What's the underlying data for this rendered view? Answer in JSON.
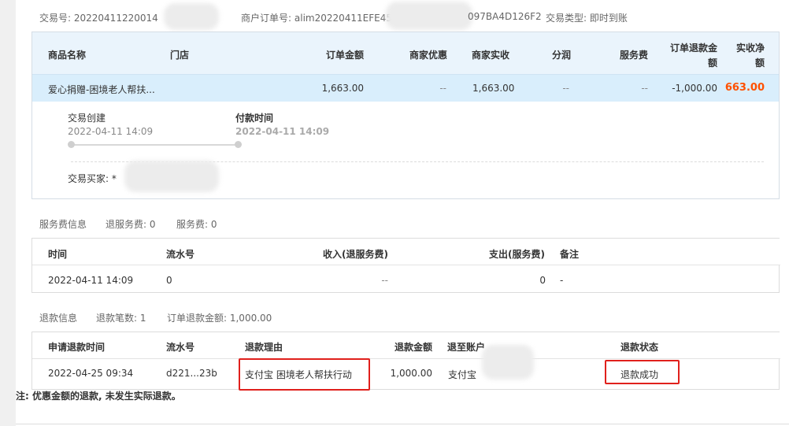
{
  "top_info": {
    "trade_no_label": "交易号:",
    "trade_no_value": "20220411220014",
    "merchant_order_label": "商户订单号:",
    "merchant_order_value": "alim20220411EFE458",
    "merchant_order_suffix": "097BA4D126F2",
    "trade_type_label": "交易类型:",
    "trade_type_value": "即时到账"
  },
  "order_table": {
    "headers": {
      "product": "商品名称",
      "store": "门店",
      "amount": "订单金额",
      "discount": "商家优惠",
      "received": "商家实收",
      "split": "分润",
      "service_fee": "服务费",
      "refund_amount_l1": "订单退款金",
      "refund_amount_l2": "额",
      "net_l1": "实收净",
      "net_l2": "额"
    },
    "row": {
      "product": "爱心捐赠-困境老人帮扶...",
      "amount": "1,663.00",
      "discount": "--",
      "received": "1,663.00",
      "split": "--",
      "service_fee": "--",
      "refund": "-1,000.00",
      "net": "663.00"
    },
    "timeline": {
      "created_label": "交易创建",
      "created_time": "2022-04-11 14:09",
      "paid_label": "付款时间",
      "paid_time": "2022-04-11 14:09"
    },
    "buyer_label": "交易买家: *"
  },
  "service_fee_info": {
    "title": "服务费信息",
    "refund_fee_label": "退服务费: 0",
    "fee_label": "服务费: 0",
    "headers": {
      "time": "时间",
      "serial": "流水号",
      "income": "收入(退服务费)",
      "expense": "支出(服务费)",
      "remark": "备注"
    },
    "row": {
      "time": "2022-04-11 14:09",
      "serial": "0",
      "income": "--",
      "expense": "0",
      "remark": "-"
    }
  },
  "refund_info": {
    "title": "退款信息",
    "count_label": "退款笔数: 1",
    "amount_label": "订单退款金额: 1,000.00",
    "headers": {
      "apply_time": "申请退款时间",
      "serial": "流水号",
      "reason": "退款理由",
      "amount": "退款金额",
      "account": "退至账户",
      "status": "退款状态"
    },
    "row": {
      "apply_time": "2022-04-25 09:34",
      "serial": "d221...23b",
      "reason": "支付宝 困境老人帮扶行动",
      "amount": "1,000.00",
      "account": "支付宝",
      "status": "退款成功"
    }
  },
  "footnote": "注: 优惠金额的退款, 未发生实际退款。",
  "colors": {
    "accent_blue": "#1a73c7",
    "net_orange": "#ff5000",
    "highlight_red": "#e0201c",
    "header_bg": "#eaf4fc",
    "row_bg": "#d9eefc"
  }
}
